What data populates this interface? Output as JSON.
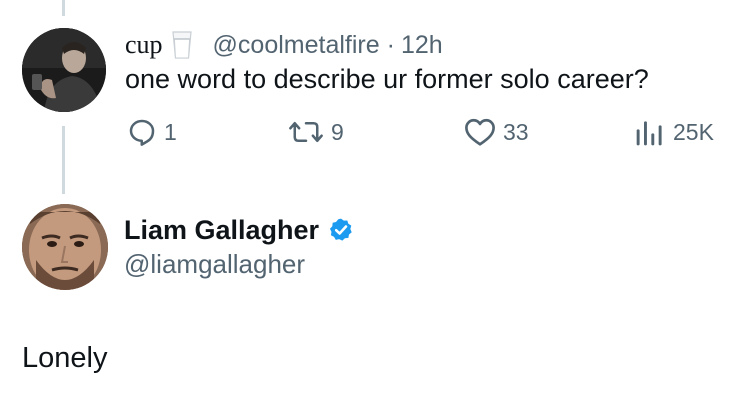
{
  "reply_tweet": {
    "author_name": "cup",
    "author_emoji": "glass-of-milk-emoji",
    "handle": "@coolmetalfire",
    "separator": "·",
    "time": "12h",
    "text": "one word to describe ur former solo career?",
    "actions": {
      "replies": "1",
      "retweets": "9",
      "likes": "33",
      "views": "25K"
    }
  },
  "main_tweet": {
    "author_name": "Liam Gallagher",
    "handle": "@liamgallagher",
    "verified": true,
    "text": "Lonely"
  },
  "colors": {
    "text_primary": "#0f1419",
    "text_secondary": "#536471",
    "thread_line": "#cfd9de",
    "verified_blue": "#1d9bf0"
  }
}
